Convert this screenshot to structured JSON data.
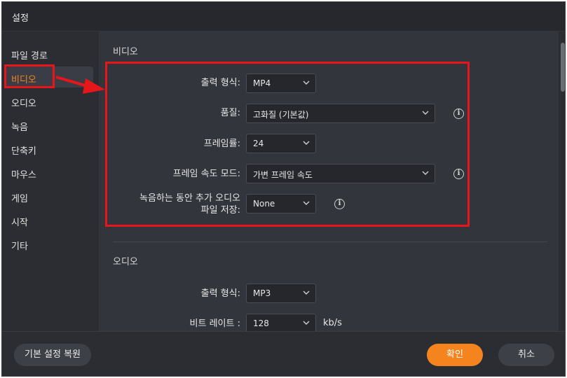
{
  "window": {
    "title": "설정"
  },
  "sidebar": {
    "items": [
      {
        "label": "파일 경로"
      },
      {
        "label": "비디오"
      },
      {
        "label": "오디오"
      },
      {
        "label": "녹음"
      },
      {
        "label": "단축키"
      },
      {
        "label": "마우스"
      },
      {
        "label": "게임"
      },
      {
        "label": "시작"
      },
      {
        "label": "기타"
      }
    ],
    "active_index": 1
  },
  "video": {
    "title": "비디오",
    "output_format": {
      "label": "출력 형식:",
      "value": "MP4"
    },
    "quality": {
      "label": "품질:",
      "value": "고화질 (기본값)"
    },
    "frame_rate": {
      "label": "프레임률:",
      "value": "24"
    },
    "frame_rate_mode": {
      "label": "프레임 속도 모드:",
      "value": "가변 프레임 속도"
    },
    "save_audio": {
      "label_line1": "녹음하는 동안 추가 오디오",
      "label_line2": "파일 저장:",
      "value": "None"
    }
  },
  "audio": {
    "title": "오디오",
    "output_format": {
      "label": "출력 형식:",
      "value": "MP3"
    },
    "bitrate": {
      "label": "비트 레이트 :",
      "value": "128",
      "unit": "kb/s"
    }
  },
  "footer": {
    "reset_label": "기본 설정 복원",
    "ok_label": "확인",
    "cancel_label": "취소"
  },
  "colors": {
    "accent": "#f5841f",
    "highlight": "#e8151b"
  }
}
